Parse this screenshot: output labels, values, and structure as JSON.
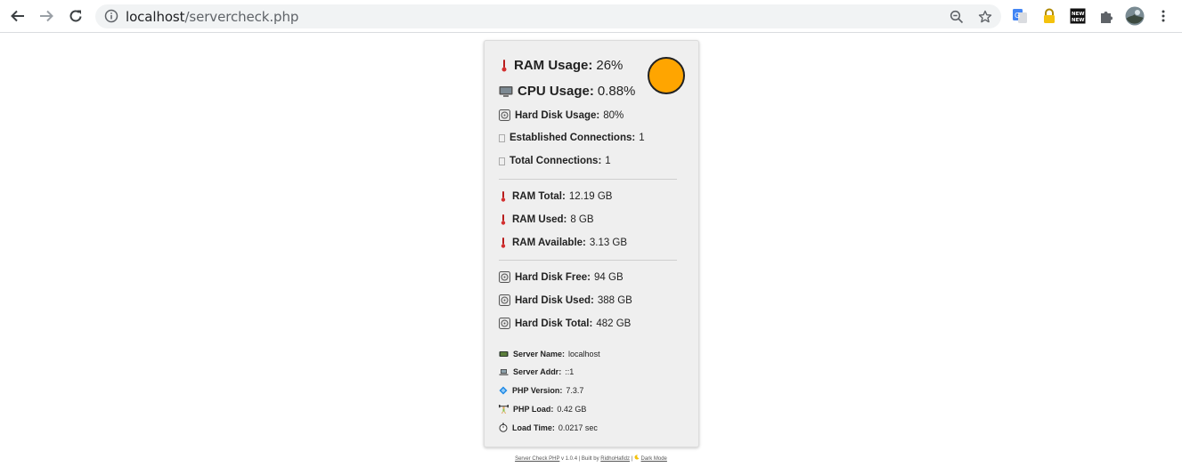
{
  "browser": {
    "url_host": "localhost",
    "url_path": "/servercheck.php"
  },
  "stats": {
    "ram_usage": {
      "label": "RAM Usage:",
      "value": "26%"
    },
    "cpu_usage": {
      "label": "CPU Usage:",
      "value": "0.88%"
    },
    "disk_usage": {
      "label": "Hard Disk Usage:",
      "value": "80%"
    },
    "established_connections": {
      "label": "Established Connections:",
      "value": "1"
    },
    "total_connections": {
      "label": "Total Connections:",
      "value": "1"
    },
    "ram_total": {
      "label": "RAM Total:",
      "value": "12.19 GB"
    },
    "ram_used": {
      "label": "RAM Used:",
      "value": "8 GB"
    },
    "ram_available": {
      "label": "RAM Available:",
      "value": "3.13 GB"
    },
    "disk_free": {
      "label": "Hard Disk Free:",
      "value": "94 GB"
    },
    "disk_used": {
      "label": "Hard Disk Used:",
      "value": "388 GB"
    },
    "disk_total": {
      "label": "Hard Disk Total:",
      "value": "482 GB"
    },
    "server_name": {
      "label": "Server Name:",
      "value": "localhost"
    },
    "server_addr": {
      "label": "Server Addr:",
      "value": "::1"
    },
    "php_version": {
      "label": "PHP Version:",
      "value": "7.3.7"
    },
    "php_load": {
      "label": "PHP Load:",
      "value": "0.42 GB"
    },
    "load_time": {
      "label": "Load Time:",
      "value": "0.0217 sec"
    }
  },
  "status_color": "#ffa500",
  "footer": {
    "app_link": "Server Check PHP",
    "version_text": "v 1.0.4 | Built by",
    "author_link": "RidhoHafidz",
    "separator": "|",
    "dark_mode_link": "Dark Mode"
  }
}
